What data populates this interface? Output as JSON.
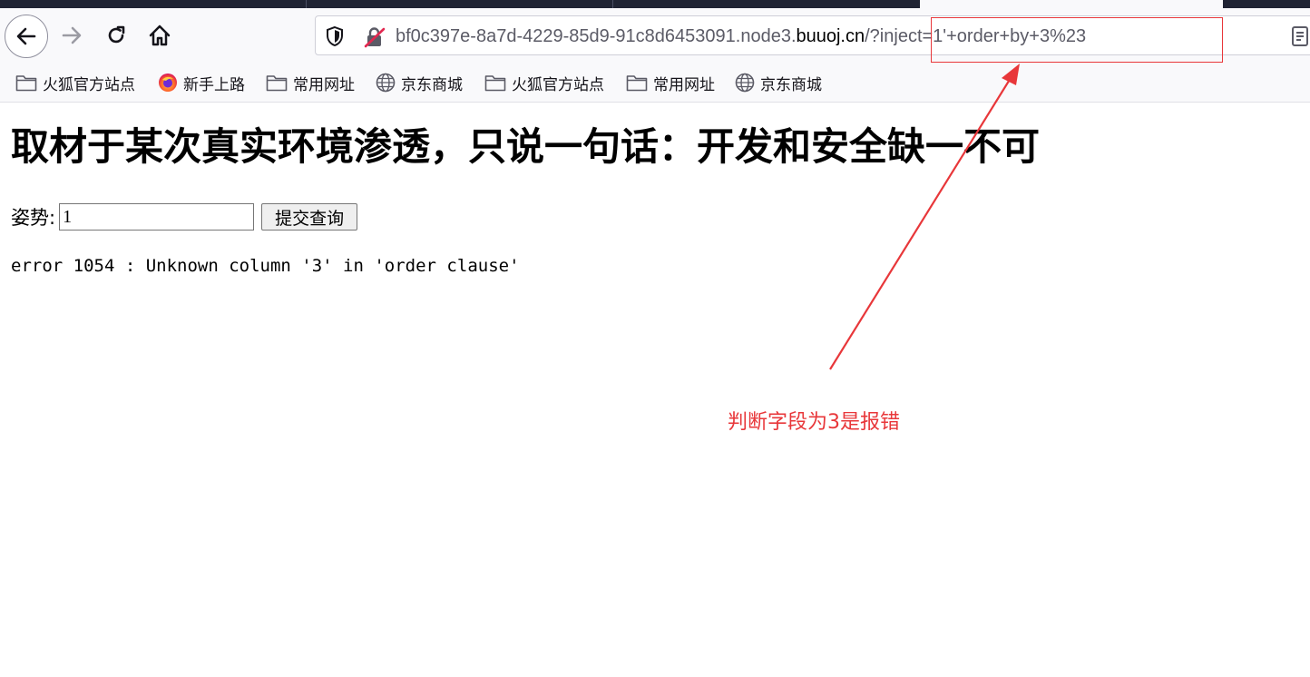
{
  "browser": {
    "url_prefix": "bf0c397e-8a7d-4229-85d9-91c8d6453091.node3.",
    "url_host": "buuoj.cn",
    "url_suffix": "/?inject=1'+order+by+3%23"
  },
  "bookmarks": [
    {
      "label": "火狐官方站点",
      "icon": "folder-icon"
    },
    {
      "label": "新手上路",
      "icon": "firefox-icon"
    },
    {
      "label": "常用网址",
      "icon": "folder-icon"
    },
    {
      "label": "京东商城",
      "icon": "globe-icon"
    },
    {
      "label": "火狐官方站点",
      "icon": "folder-icon"
    },
    {
      "label": "常用网址",
      "icon": "folder-icon"
    },
    {
      "label": "京东商城",
      "icon": "globe-icon"
    }
  ],
  "page": {
    "title": "取材于某次真实环境渗透，只说一句话：开发和安全缺一不可",
    "form_label": "姿势:",
    "input_value": "1",
    "submit_label": "提交查询",
    "error": "error 1054 : Unknown column '3' in 'order clause'"
  },
  "annotation": {
    "text": "判断字段为3是报错",
    "color": "#e8373a"
  }
}
